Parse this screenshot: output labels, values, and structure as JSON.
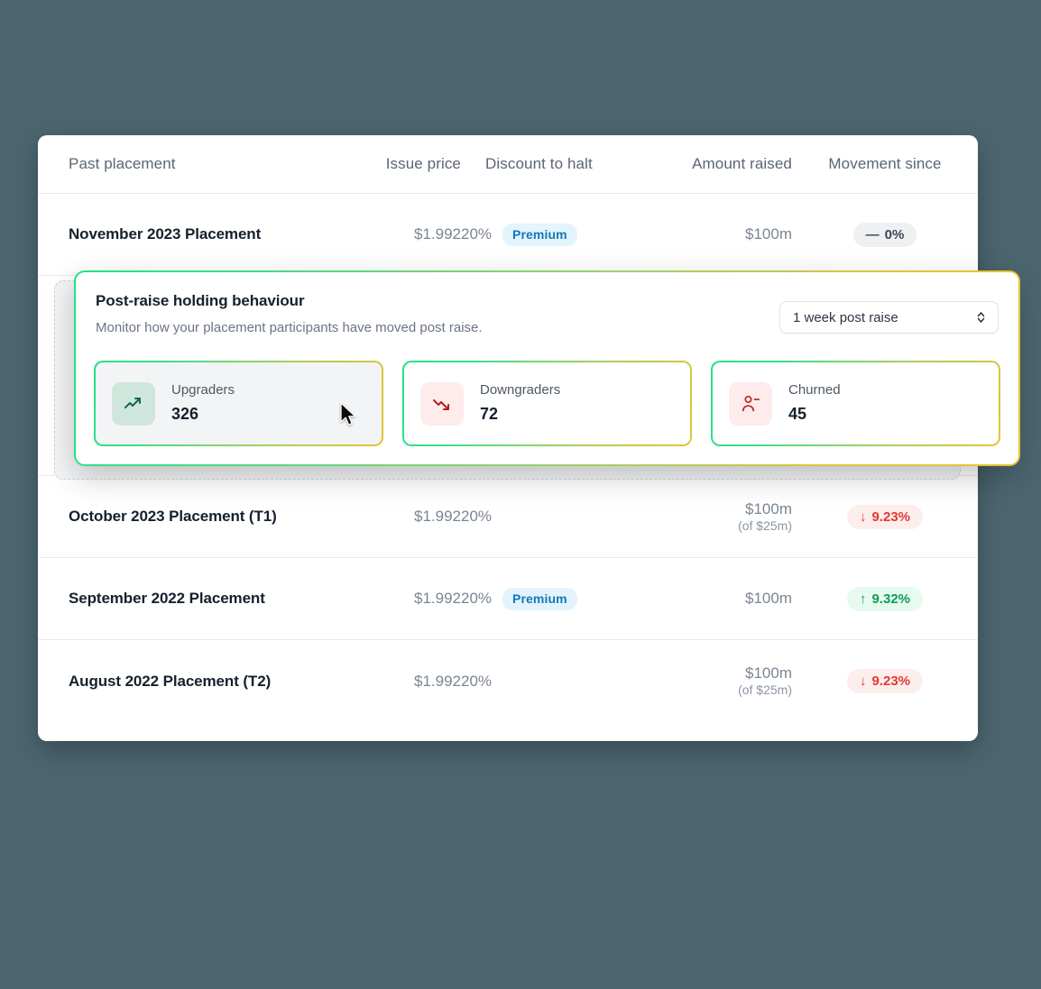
{
  "background_color": "#4c6670",
  "table": {
    "columns": [
      {
        "key": "placement",
        "label": "Past placement"
      },
      {
        "key": "issue_price",
        "label": "Issue price"
      },
      {
        "key": "discount",
        "label": "Discount to halt"
      },
      {
        "key": "amount",
        "label": "Amount raised"
      },
      {
        "key": "movement",
        "label": "Movement since"
      }
    ],
    "rows": [
      {
        "placement": "November 2023 Placement",
        "issue_price": "$1.992",
        "discount": "20%",
        "discount_badge": "Premium",
        "amount": "$100m",
        "amount_sub": "",
        "movement": "0%",
        "movement_arrow": "—",
        "movement_state": "neutral"
      },
      {
        "placement": "October 2023 Placement (T1)",
        "issue_price": "$1.992",
        "discount": "20%",
        "discount_badge": "",
        "amount": "$100m",
        "amount_sub": "(of $25m)",
        "movement": "9.23%",
        "movement_arrow": "↓",
        "movement_state": "down"
      },
      {
        "placement": "September 2022 Placement",
        "issue_price": "$1.992",
        "discount": "20%",
        "discount_badge": "Premium",
        "amount": "$100m",
        "amount_sub": "",
        "movement": "9.32%",
        "movement_arrow": "↑",
        "movement_state": "up"
      },
      {
        "placement": "August 2022 Placement (T2)",
        "issue_price": "$1.992",
        "discount": "20%",
        "discount_badge": "",
        "amount": "$100m",
        "amount_sub": "(of $25m)",
        "movement": "9.23%",
        "movement_arrow": "↓",
        "movement_state": "down"
      }
    ]
  },
  "overlay": {
    "title": "Post-raise holding behaviour",
    "subtitle": "Monitor how your placement participants have moved post raise.",
    "period_select": {
      "value": "1 week post raise",
      "icon": "selector-up-down-icon"
    },
    "metrics": [
      {
        "icon": "trending-up-icon",
        "label": "Upgraders",
        "value": "326",
        "state": "hovered"
      },
      {
        "icon": "trending-down-icon",
        "label": "Downgraders",
        "value": "72",
        "state": "default"
      },
      {
        "icon": "user-minus-icon",
        "label": "Churned",
        "value": "45",
        "state": "default"
      }
    ]
  },
  "colors": {
    "accent_gradient_start": "#22e189",
    "accent_gradient_end": "#e8c32f",
    "premium_badge_bg": "#e3f4fd",
    "premium_badge_text": "#1578b8",
    "up_text": "#0e9c56",
    "down_text": "#e03a32"
  }
}
